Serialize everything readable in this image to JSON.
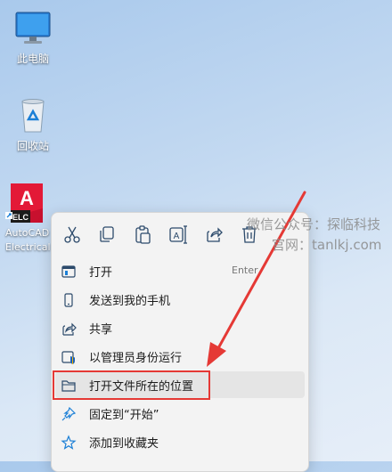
{
  "desktop": {
    "icons": [
      {
        "label": "此电脑",
        "icon": "monitor-icon"
      },
      {
        "label": "回收站",
        "icon": "recycle-bin-icon"
      },
      {
        "label": "AutoCAD Electrical",
        "icon": "autocad-electrical-icon",
        "badge": "ELC"
      }
    ]
  },
  "context_menu": {
    "toolbar": [
      "cut-icon",
      "copy-icon",
      "paste-icon",
      "rename-icon",
      "share-icon",
      "delete-icon"
    ],
    "items": [
      {
        "label": "打开",
        "shortcut": "Enter",
        "icon": "open-icon"
      },
      {
        "label": "发送到我的手机",
        "icon": "phone-icon"
      },
      {
        "label": "共享",
        "icon": "share-icon"
      },
      {
        "label": "以管理员身份运行",
        "icon": "shield-icon"
      },
      {
        "label": "打开文件所在的位置",
        "icon": "folder-icon",
        "highlighted": true
      },
      {
        "label": "固定到“开始”",
        "icon": "pin-icon"
      },
      {
        "label": "添加到收藏夹",
        "icon": "star-icon"
      }
    ]
  },
  "watermark": {
    "line1": "微信公众号：探临科技",
    "line2": "官网：tanlkj.com"
  },
  "annotation": {
    "box_color": "#e53935",
    "arrow_color": "#e53935"
  }
}
